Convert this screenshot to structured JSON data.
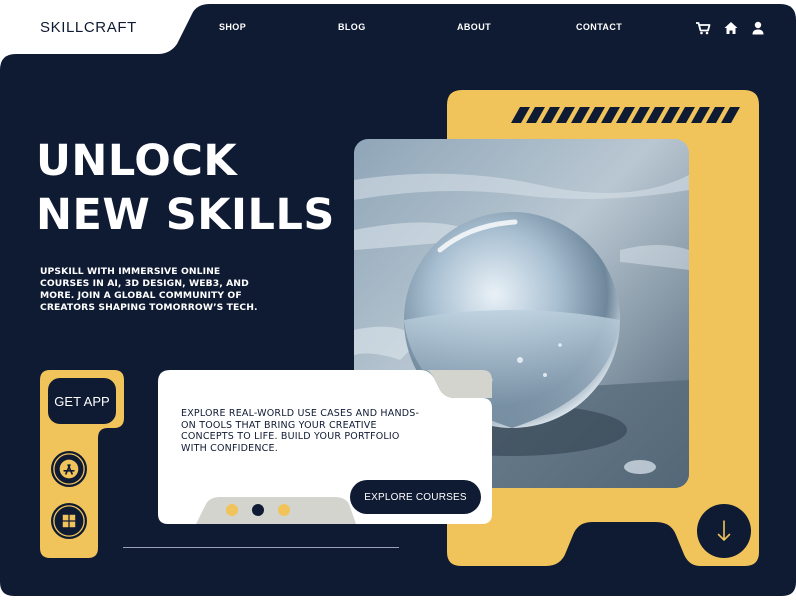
{
  "brand": {
    "name": "SKILLCRAFT"
  },
  "nav": {
    "items": [
      "SHOP",
      "BLOG",
      "ABOUT",
      "CONTACT"
    ],
    "icons": [
      "cart-icon",
      "home-icon",
      "user-icon"
    ]
  },
  "hero": {
    "title_line1": "UNLOCK",
    "title_line2": "NEW SKILLS",
    "description": "UPSKILL WITH IMMERSIVE ONLINE COURSES IN AI, 3D DESIGN, WEB3, AND MORE. JOIN A GLOBAL COMMUNITY OF CREATORS SHAPING TOMORROW’S TECH."
  },
  "app_panel": {
    "get_app_label": "GET APP",
    "store_icons": [
      "app-store-icon",
      "windows-store-icon"
    ]
  },
  "card": {
    "text": "EXPLORE REAL-WORLD USE CASES AND HANDS-ON TOOLS THAT BRING YOUR CREATIVE CONCEPTS TO LIFE. BUILD YOUR PORTFOLIO WITH CONFIDENCE.",
    "button_label": "EXPLORE COURSES",
    "slides_total": 3,
    "active_slide": 2
  },
  "scroll": {
    "icon": "arrow-down-icon"
  },
  "colors": {
    "navy": "#0f1a33",
    "yellow": "#f1c45b",
    "white": "#ffffff",
    "card_tab_gray": "#d3d4cd"
  }
}
